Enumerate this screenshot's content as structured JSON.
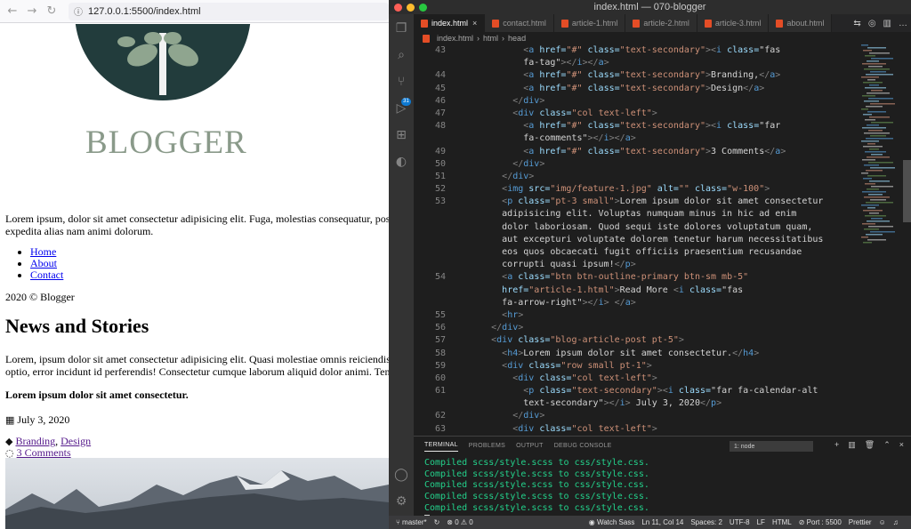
{
  "browser": {
    "url": "127.0.0.1:5500/index.html",
    "site_title": "BLOGGER",
    "intro": "Lorem ipsum, dolor sit amet consectetur adipisicing elit. Fuga, molestias consequatur, possimu",
    "intro_2": "expedita alias nam animi dolorum.",
    "nav": [
      "Home",
      "About",
      "Contact"
    ],
    "copyright": "2020 © Blogger",
    "news_heading": "News and Stories",
    "news_para_1": "Lorem, ipsum dolor sit amet consectetur adipisicing elit. Quasi molestiae omnis reiciendis sapi",
    "news_para_2": "optio, error incidunt id perferendis! Consectetur cumque laborum aliquid dolor animi. Tenetur,",
    "post_title": "Lorem ipsum dolor sit amet consectetur.",
    "post_date": "July 3, 2020",
    "tag_1": "Branding",
    "tag_2": "Design",
    "comments": "3 Comments"
  },
  "vscode": {
    "window_title": "index.html — 070-blogger",
    "tabs": [
      "index.html",
      "contact.html",
      "article-1.html",
      "article-2.html",
      "article-3.html",
      "about.html"
    ],
    "breadcrumb": [
      "index.html",
      "html",
      "head"
    ],
    "badge": "31",
    "code_lines": [
      {
        "n": "43",
        "t": "            <a href=\"#\" class=\"text-secondary\"><i class=\"fas"
      },
      {
        "n": "",
        "t": "            fa-tag\"></i></a>"
      },
      {
        "n": "44",
        "t": "            <a href=\"#\" class=\"text-secondary\">Branding,</a>"
      },
      {
        "n": "45",
        "t": "            <a href=\"#\" class=\"text-secondary\">Design</a>"
      },
      {
        "n": "46",
        "t": "          </div>"
      },
      {
        "n": "47",
        "t": "          <div class=\"col text-left\">"
      },
      {
        "n": "48",
        "t": "            <a href=\"#\" class=\"text-secondary\"><i class=\"far"
      },
      {
        "n": "",
        "t": "            fa-comments\"></i></a>"
      },
      {
        "n": "49",
        "t": "            <a href=\"#\" class=\"text-secondary\">3 Comments</a>"
      },
      {
        "n": "50",
        "t": "          </div>"
      },
      {
        "n": "51",
        "t": "        </div>"
      },
      {
        "n": "52",
        "t": "        <img src=\"img/feature-1.jpg\" alt=\"\" class=\"w-100\">"
      },
      {
        "n": "53",
        "t": "        <p class=\"pt-3 small\">Lorem ipsum dolor sit amet consectetur"
      },
      {
        "n": "",
        "t": "        adipisicing elit. Voluptas numquam minus in hic ad enim"
      },
      {
        "n": "",
        "t": "        dolor laboriosam. Quod sequi iste dolores voluptatum quam,"
      },
      {
        "n": "",
        "t": "        aut excepturi voluptate dolorem tenetur harum necessitatibus"
      },
      {
        "n": "",
        "t": "        eos quos obcaecati fugit officiis praesentium recusandae"
      },
      {
        "n": "",
        "t": "        corrupti quasi ipsum!</p>"
      },
      {
        "n": "54",
        "t": "        <a class=\"btn btn-outline-primary btn-sm mb-5\""
      },
      {
        "n": "",
        "t": "        href=\"article-1.html\">Read More <i class=\"fas"
      },
      {
        "n": "",
        "t": "        fa-arrow-right\"></i> </a>"
      },
      {
        "n": "55",
        "t": "        <hr>"
      },
      {
        "n": "56",
        "t": "      </div>"
      },
      {
        "n": "57",
        "t": "      <div class=\"blog-article-post pt-5\">"
      },
      {
        "n": "58",
        "t": "        <h4>Lorem ipsum dolor sit amet consectetur.</h4>"
      },
      {
        "n": "59",
        "t": "        <div class=\"row small pt-1\">"
      },
      {
        "n": "60",
        "t": "          <div class=\"col text-left\">"
      },
      {
        "n": "61",
        "t": "            <p class=\"text-secondary\"><i class=\"far fa-calendar-alt"
      },
      {
        "n": "",
        "t": "            text-secondary\"></i> July 3, 2020</p>"
      },
      {
        "n": "62",
        "t": "          </div>"
      },
      {
        "n": "63",
        "t": "          <div class=\"col text-left\">"
      }
    ],
    "panel_tabs": [
      "TERMINAL",
      "PROBLEMS",
      "OUTPUT",
      "DEBUG CONSOLE"
    ],
    "terminal_select": "1: node",
    "terminal_lines": [
      "Compiled scss/style.scss to css/style.css.",
      "Compiled scss/style.scss to css/style.css.",
      "Compiled scss/style.scss to css/style.css.",
      "Compiled scss/style.scss to css/style.css.",
      "Compiled scss/style.scss to css/style.css."
    ],
    "status": {
      "branch": "master*",
      "errors": "⊗ 0 ⚠ 0",
      "watch": "Watch Sass",
      "position": "Ln 11, Col 14",
      "spaces": "Spaces: 2",
      "encoding": "UTF-8",
      "eol": "LF",
      "language": "HTML",
      "port": "Port : 5500",
      "formatter": "Prettier"
    }
  },
  "colors": {
    "logo_bg": "#223c3c",
    "title": "#8a9a8a",
    "terminal_green": "#23d18b",
    "html_icon": "#e44d26"
  }
}
